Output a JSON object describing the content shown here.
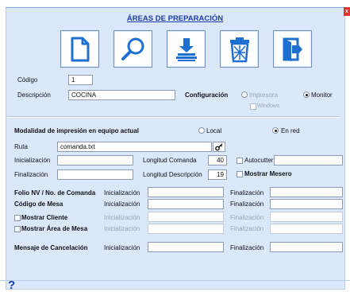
{
  "window": {
    "title": "ÁREAS DE PREPARACIÓN",
    "close_label": "x"
  },
  "toolbar": {
    "buttons": [
      {
        "name": "new-document",
        "icon": "document-icon"
      },
      {
        "name": "search",
        "icon": "magnifier-icon"
      },
      {
        "name": "stack",
        "icon": "stack-icon"
      },
      {
        "name": "delete",
        "icon": "trash-icon"
      },
      {
        "name": "exit",
        "icon": "exit-icon"
      }
    ]
  },
  "form": {
    "codigo_label": "Código",
    "codigo_value": "1",
    "descripcion_label": "Descripción",
    "descripcion_value": "COCINA",
    "configuracion_label": "Configuración",
    "impresora_label": "Impresora",
    "monitor_label": "Monitor",
    "windows_label": "Windows",
    "config_selected": "monitor"
  },
  "printing": {
    "modalidad_label": "Modalidad de impresión en equipo actual",
    "local_label": "Local",
    "en_red_label": "En red",
    "mode_selected": "en_red",
    "ruta_label": "Ruta",
    "ruta_value": "comanda.txt",
    "inicializacion_label": "Inicialización",
    "inicializacion_value": "",
    "longitud_comanda_label": "Longitud Comanda",
    "longitud_comanda_value": "40",
    "autocutter_label": "Autocutter",
    "autocutter_value": "",
    "finalizacion_label": "Finalización",
    "finalizacion_value": "",
    "longitud_descripcion_label": "Longitud Descripción",
    "longitud_descripcion_value": "19",
    "mostrar_mesero_label": "Mostrar Mesero"
  },
  "folio": {
    "rows": [
      {
        "label": "Folio NV / No. de Comanda",
        "init_label": "Inicialización",
        "fin_label": "Finalización",
        "enabled": true,
        "checkbox": false
      },
      {
        "label": "Código de Mesa",
        "init_label": "Inicialización",
        "fin_label": "Finalización",
        "enabled": true,
        "checkbox": false
      },
      {
        "label": "Mostrar Cliente",
        "init_label": "Inicialización",
        "fin_label": "Finalización",
        "enabled": false,
        "checkbox": true
      },
      {
        "label": "Mostrar Área de Mesa",
        "init_label": "Inicialización",
        "fin_label": "Finalización",
        "enabled": false,
        "checkbox": true
      }
    ],
    "cancel_label": "Mensaje de Cancelación",
    "cancel_init_label": "Inicialización",
    "cancel_fin_label": "Finalización"
  },
  "footer": {
    "help_label": "?"
  },
  "colors": {
    "panel": "#dbe8fb",
    "title": "#1d3ea8",
    "icon_blue": "#1f6fd1"
  }
}
